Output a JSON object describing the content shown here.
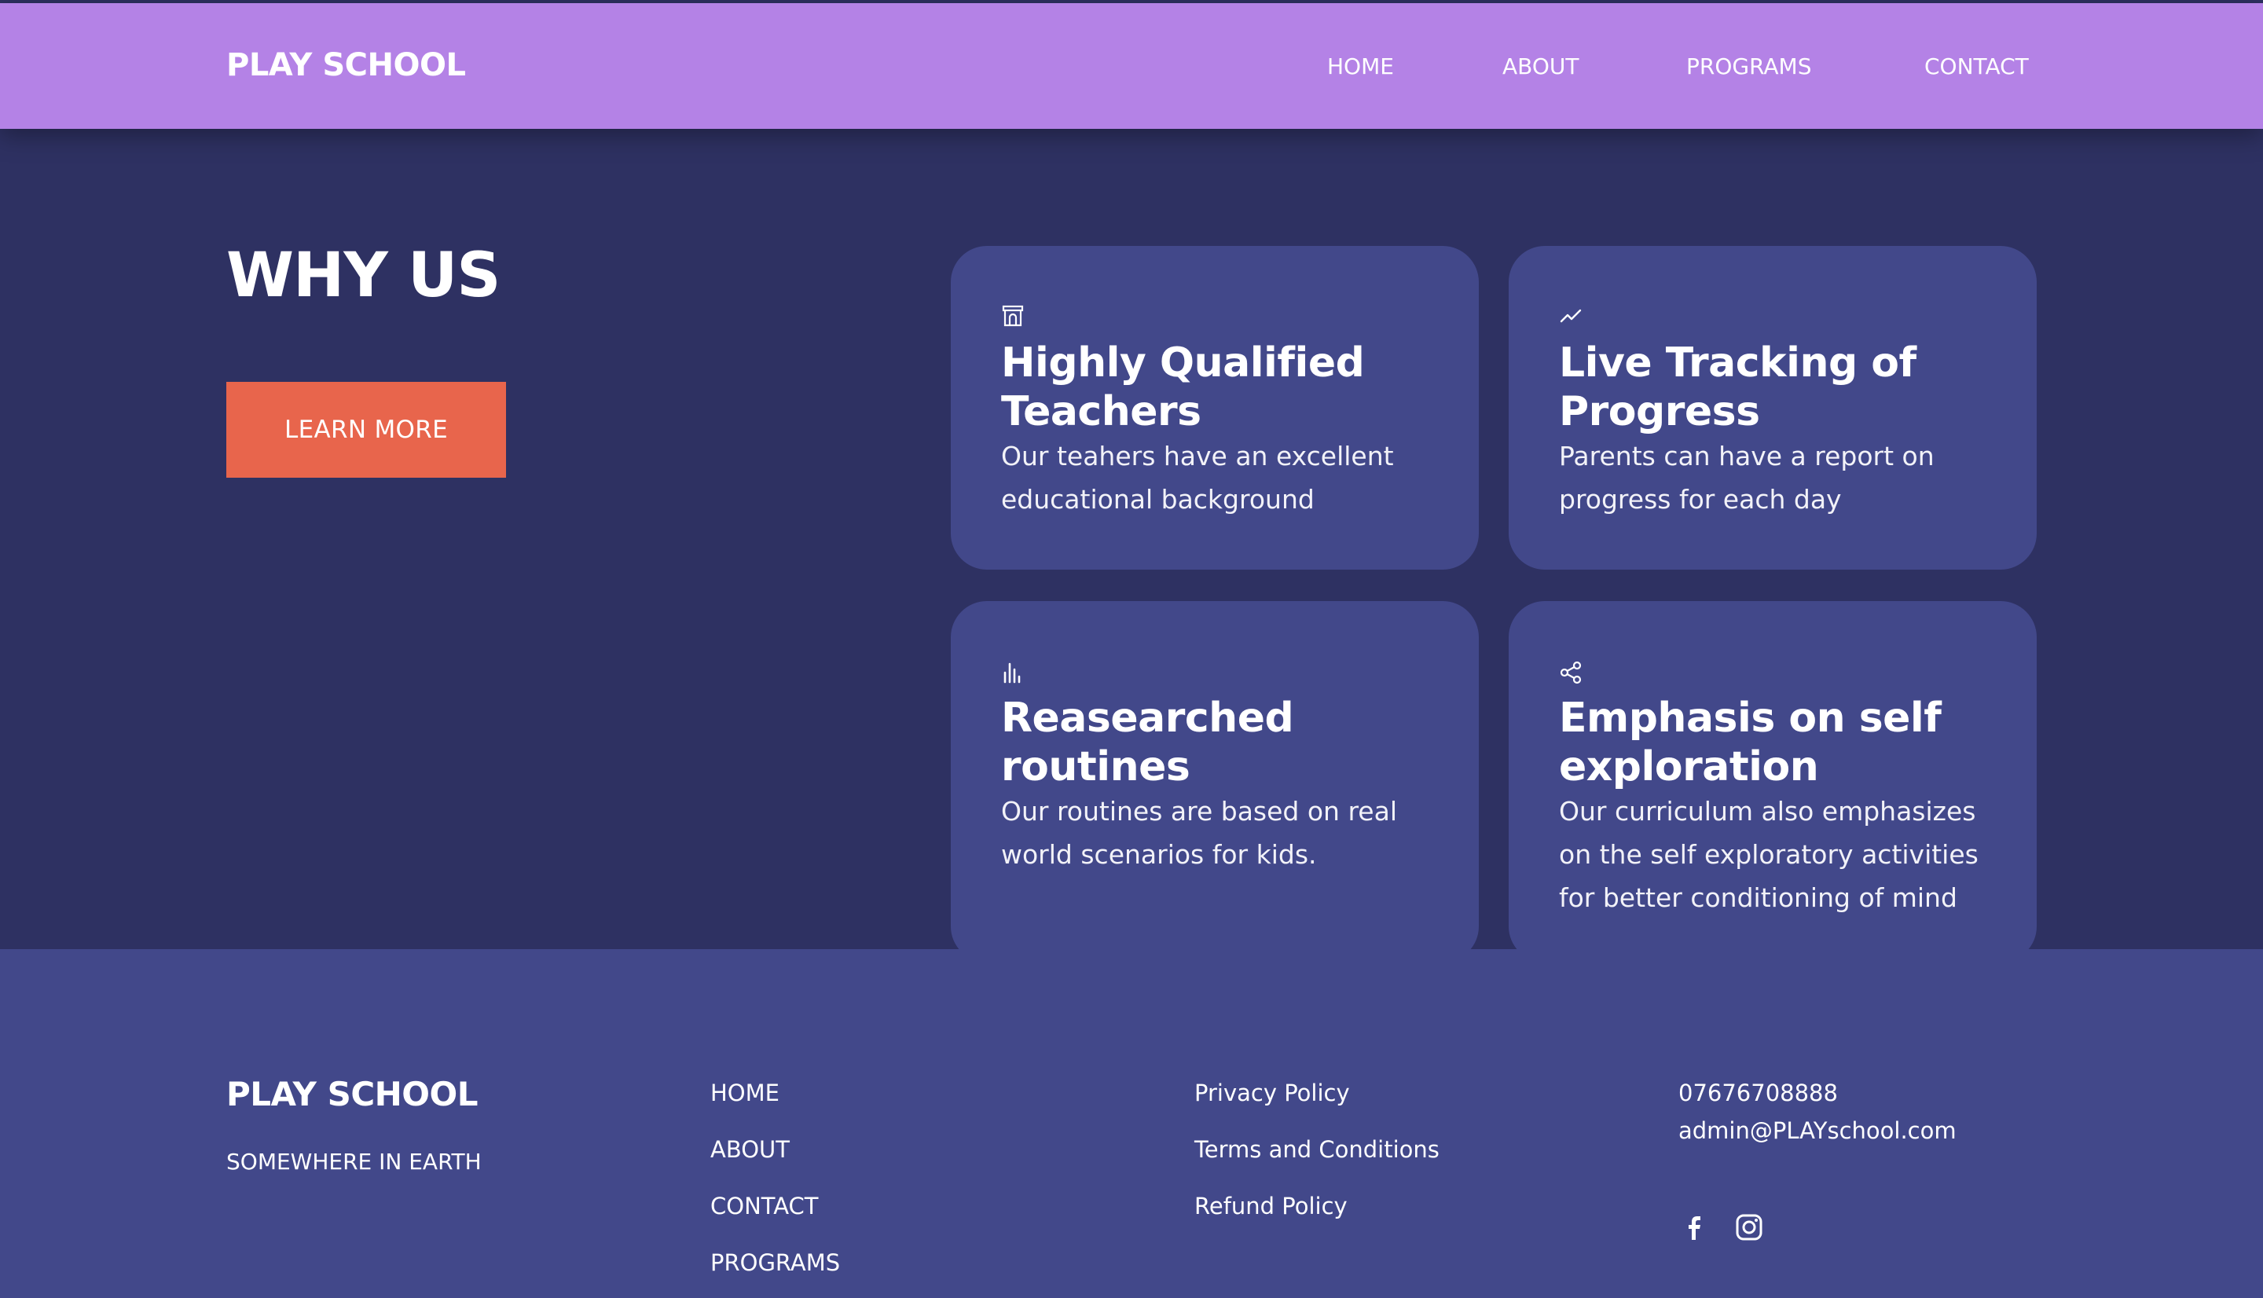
{
  "header": {
    "brand": "PLAY SCHOOL",
    "nav": [
      "HOME",
      "ABOUT",
      "PROGRAMS",
      "CONTACT"
    ]
  },
  "hero": {
    "title": "WHY US",
    "button_label": "LEARN MORE"
  },
  "cards": [
    {
      "icon": "building-icon",
      "title": "Highly Qualified Teachers",
      "desc": "Our teahers have an excellent educational background"
    },
    {
      "icon": "trend-line-icon",
      "title": "Live Tracking of Progress",
      "desc": "Parents can have a report on progress for each day"
    },
    {
      "icon": "bar-chart-icon",
      "title": "Reasearched routines",
      "desc": "Our routines are based on real world scenarios for kids."
    },
    {
      "icon": "share-icon",
      "title": "Emphasis on self exploration",
      "desc": "Our curriculum also emphasizes on the self exploratory activities for better conditioning of mind"
    }
  ],
  "footer": {
    "brand": "PLAY SCHOOL",
    "address": "SOMEWHERE IN EARTH",
    "nav": [
      "HOME",
      "ABOUT",
      "CONTACT",
      "PROGRAMS"
    ],
    "policies": [
      "Privacy Policy",
      "Terms and Conditions",
      "Refund Policy"
    ],
    "phone": "07676708888",
    "email": "admin@PLAYschool.com",
    "social": [
      "facebook-icon",
      "instagram-icon"
    ]
  },
  "colors": {
    "header_bg": "#b482e6",
    "page_bg": "#2e3162",
    "card_bg": "#42488a",
    "button_bg": "#e8654c"
  }
}
